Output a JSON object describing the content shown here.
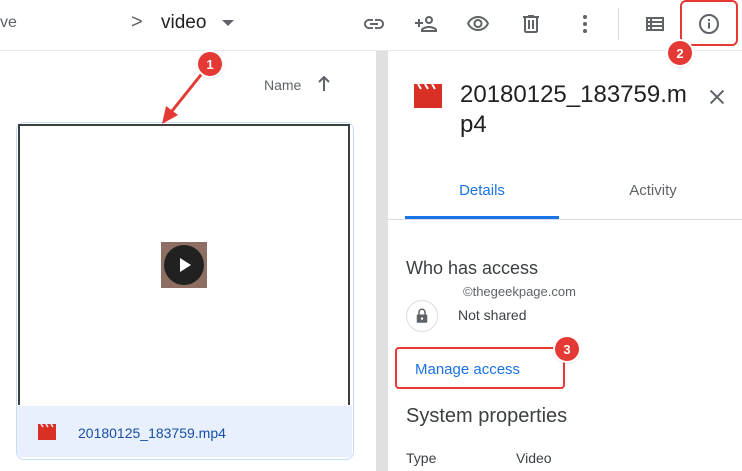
{
  "breadcrumb": {
    "previous_fragment": "ve",
    "separator": ">",
    "current_folder": "video"
  },
  "toolbar": {
    "icons": [
      "link-icon",
      "share-icon",
      "preview-icon",
      "trash-icon",
      "more-vert-icon",
      "list-view-icon",
      "info-icon"
    ]
  },
  "list": {
    "sort_label": "Name",
    "file": {
      "name": "20180125_183759.mp4",
      "icon": "video-file-icon"
    }
  },
  "details": {
    "title": "20180125_183759.mp4",
    "tabs": [
      {
        "label": "Details",
        "active": true
      },
      {
        "label": "Activity",
        "active": false
      }
    ],
    "who_has_access_heading": "Who has access",
    "watermark": "©thegeekpage.com",
    "sharing_status": "Not shared",
    "manage_access_label": "Manage access",
    "system_properties_heading": "System properties",
    "properties": [
      {
        "key": "Type",
        "value": "Video"
      }
    ]
  },
  "annotations": {
    "step1": "1",
    "step2": "2",
    "step3": "3"
  },
  "colors": {
    "accent": "#1a73e8",
    "annotation_red": "#e53935",
    "video_icon_red": "#d93025",
    "selection_bg": "#e8f0fe"
  }
}
